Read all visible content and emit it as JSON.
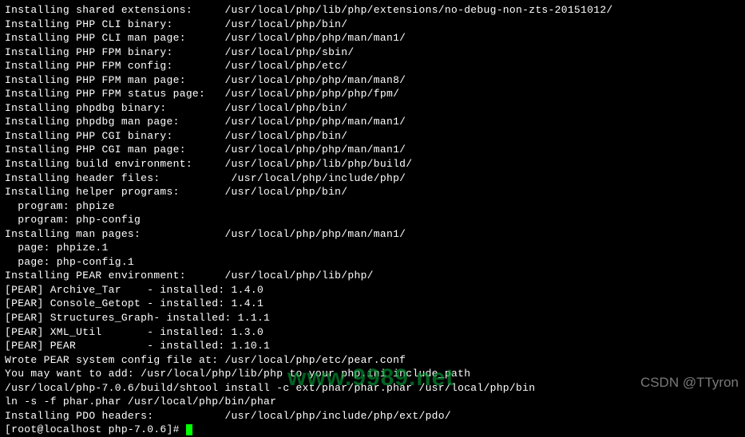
{
  "installs": [
    {
      "label": "Installing shared extensions:     ",
      "path": "/usr/local/php/lib/php/extensions/no-debug-non-zts-20151012/"
    },
    {
      "label": "Installing PHP CLI binary:        ",
      "path": "/usr/local/php/bin/"
    },
    {
      "label": "Installing PHP CLI man page:      ",
      "path": "/usr/local/php/php/man/man1/"
    },
    {
      "label": "Installing PHP FPM binary:        ",
      "path": "/usr/local/php/sbin/"
    },
    {
      "label": "Installing PHP FPM config:        ",
      "path": "/usr/local/php/etc/"
    },
    {
      "label": "Installing PHP FPM man page:      ",
      "path": "/usr/local/php/php/man/man8/"
    },
    {
      "label": "Installing PHP FPM status page:   ",
      "path": "/usr/local/php/php/php/fpm/"
    },
    {
      "label": "Installing phpdbg binary:         ",
      "path": "/usr/local/php/bin/"
    },
    {
      "label": "Installing phpdbg man page:       ",
      "path": "/usr/local/php/php/man/man1/"
    },
    {
      "label": "Installing PHP CGI binary:        ",
      "path": "/usr/local/php/bin/"
    },
    {
      "label": "Installing PHP CGI man page:      ",
      "path": "/usr/local/php/php/man/man1/"
    },
    {
      "label": "Installing build environment:     ",
      "path": "/usr/local/php/lib/php/build/"
    },
    {
      "label": "Installing header files:           ",
      "path": "/usr/local/php/include/php/"
    },
    {
      "label": "Installing helper programs:       ",
      "path": "/usr/local/php/bin/"
    }
  ],
  "helper_programs": [
    "  program: phpize",
    "  program: php-config"
  ],
  "man_pages_install": {
    "label": "Installing man pages:             ",
    "path": "/usr/local/php/php/man/man1/"
  },
  "man_pages": [
    "  page: phpize.1",
    "  page: php-config.1"
  ],
  "pear_env": {
    "label": "Installing PEAR environment:      ",
    "path": "/usr/local/php/lib/php/"
  },
  "pear_packages": [
    "[PEAR] Archive_Tar    - installed: 1.4.0",
    "[PEAR] Console_Getopt - installed: 1.4.1",
    "[PEAR] Structures_Graph- installed: 1.1.1",
    "[PEAR] XML_Util       - installed: 1.3.0",
    "[PEAR] PEAR           - installed: 1.10.1"
  ],
  "footer_lines": [
    "Wrote PEAR system config file at: /usr/local/php/etc/pear.conf",
    "You may want to add: /usr/local/php/lib/php to your php.ini include_path",
    "/usr/local/php-7.0.6/build/shtool install -c ext/phar/phar.phar /usr/local/php/bin",
    "ln -s -f phar.phar /usr/local/php/bin/phar",
    "Installing PDO headers:           /usr/local/php/include/php/ext/pdo/"
  ],
  "prompt": {
    "user_host": "[root@localhost ",
    "cwd": "php-7.0.6",
    "suffix": "]# "
  },
  "watermarks": {
    "green": "www.9989.net",
    "csdn": "CSDN @TTyron"
  }
}
